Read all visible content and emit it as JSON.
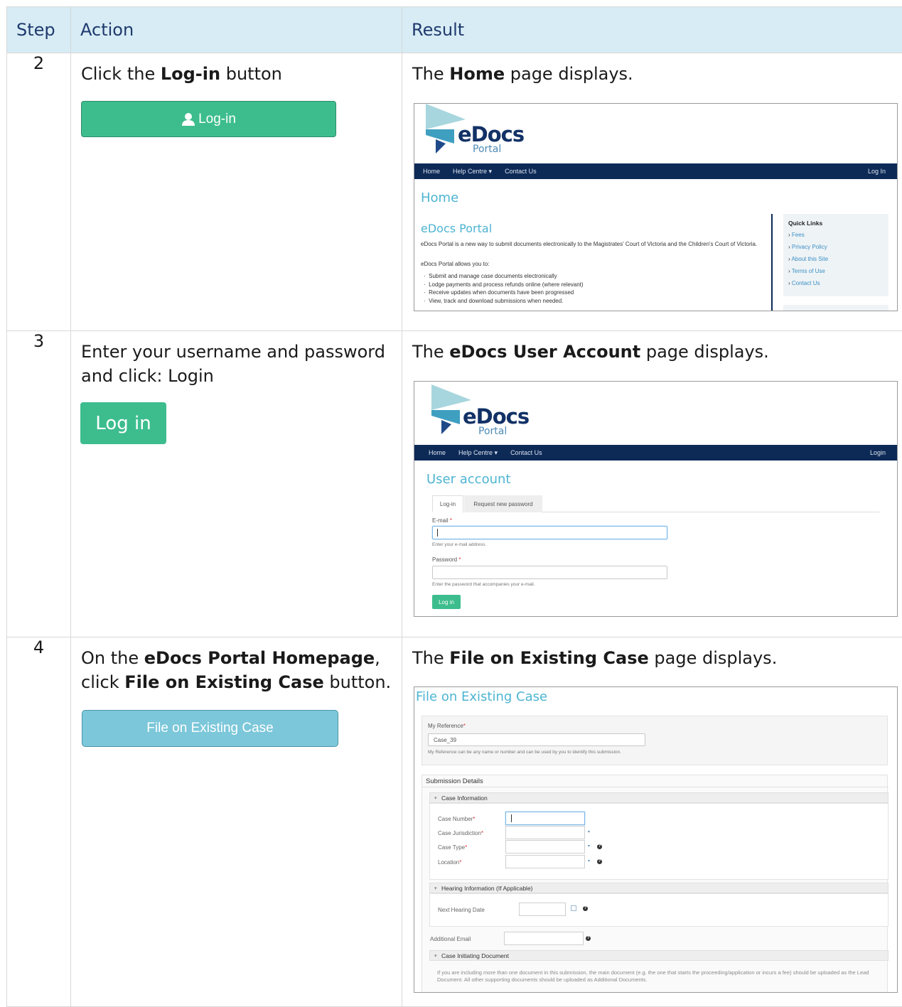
{
  "table": {
    "headers": {
      "step": "Step",
      "action": "Action",
      "result": "Result"
    },
    "rows": [
      {
        "step": "2",
        "action_pre": "Click the ",
        "action_bold": "Log-in",
        "action_post": " button",
        "action_button": "Log-in",
        "result_pre": "The ",
        "result_bold": "Home",
        "result_post": " page displays."
      },
      {
        "step": "3",
        "action_text": "Enter your username and password and click: Login",
        "action_button": "Log in",
        "result_pre": "The ",
        "result_bold": "eDocs User Account",
        "result_post": " page displays."
      },
      {
        "step": "4",
        "action_pre": "On the ",
        "action_bold1": "eDocs Portal Homepage",
        "action_mid": ", click ",
        "action_bold2": "File on Existing Case",
        "action_post": " button.",
        "action_button": "File on Existing Case",
        "result_pre": "The ",
        "result_bold": "File on Existing Case",
        "result_post": " page displays."
      }
    ]
  },
  "logo": {
    "word": "eDocs",
    "sub": "Portal"
  },
  "shot_home": {
    "nav": [
      "Home",
      "Help Centre ▾",
      "Contact Us"
    ],
    "nav_right": "Log In",
    "page_title": "Home",
    "section_title": "eDocs Portal",
    "intro": "eDocs Portal is a new way to submit documents electronically to the Magistrates' Court of Victoria and the Children's Court of Victoria.",
    "allows": "eDocs Portal allows you to:",
    "bullets": [
      "Submit and manage case documents electronically",
      "Lodge payments and process refunds online (where relevant)",
      "Receive updates when documents have been progressed",
      "View, track and download submissions when needed."
    ],
    "quick_links_title": "Quick Links",
    "quick_links": [
      "Fees",
      "Privacy Policy",
      "About this Site",
      "Terms of Use",
      "Contact Us"
    ]
  },
  "shot_account": {
    "nav": [
      "Home",
      "Help Centre ▾",
      "Contact Us"
    ],
    "nav_right": "Login",
    "page_title": "User account",
    "tabs": [
      "Log-in",
      "Request new password"
    ],
    "email_label": "E-mail",
    "email_hint": "Enter your e-mail address.",
    "password_label": "Password",
    "password_hint": "Enter the password that accompanies your e-mail.",
    "submit": "Log in",
    "required_mark": "*"
  },
  "shot_file": {
    "page_title": "File on Existing Case",
    "my_reference_label": "My Reference",
    "my_reference_value": "Case_39",
    "my_reference_hint": "My Reference can be any name or number and can be used by you to identify this submission.",
    "submission_details": "Submission Details",
    "case_information": "Case Information",
    "case_fields": [
      "Case Number",
      "Case Jurisdiction",
      "Case Type",
      "Location"
    ],
    "hearing_information": "Hearing Information (If Applicable)",
    "next_hearing_date": "Next Hearing Date",
    "additional_email": "Additional Email",
    "case_initiating_document": "Case Initiating Document",
    "cid_note": "If you are including more than one document in this submission, the main document (e.g. the one that starts the proceeding/application or incurs a fee) should be uploaded as the Lead Document. All other supporting documents should be uploaded as Additional Documents.",
    "required_mark": "*"
  }
}
